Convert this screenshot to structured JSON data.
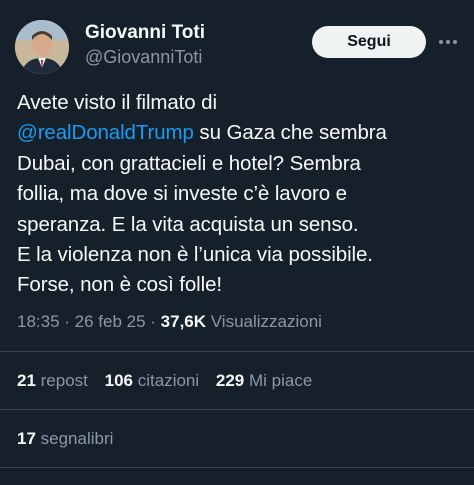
{
  "author": {
    "name": "Giovanni Toti",
    "handle": "@GiovanniToti"
  },
  "follow_label": "Segui",
  "more_icon": "more-horizontal-icon",
  "tweet": {
    "line1": "Avete visto il filmato di",
    "mention": "@realDonaldTrump",
    "line2_rest": " su Gaza che sembra",
    "line3": "Dubai, con grattacieli e hotel? Sembra",
    "line4": "follia, ma dove si investe c’è lavoro e",
    "line5": "speranza. E la vita acquista un senso.",
    "line6": "E la violenza non è l’unica via possibile.",
    "line7": "Forse, non è così folle!"
  },
  "meta": {
    "time": "18:35",
    "sep1": " · ",
    "date": "26 feb 25",
    "sep2": " · ",
    "views": "37,6K",
    "views_label": " Visualizzazioni"
  },
  "stats": {
    "reposts": "21",
    "reposts_label": " repost",
    "quotes": "106",
    "quotes_label": " citazioni",
    "likes": "229",
    "likes_label": " Mi piace"
  },
  "bookmarks": {
    "count": "17",
    "label": " segnalibri"
  },
  "colors": {
    "background": "#15202b",
    "text": "#f7f9f9",
    "secondary": "#8b98a5",
    "link": "#1d9bf0",
    "divider": "#38444d",
    "button_bg": "#eff3f4"
  }
}
